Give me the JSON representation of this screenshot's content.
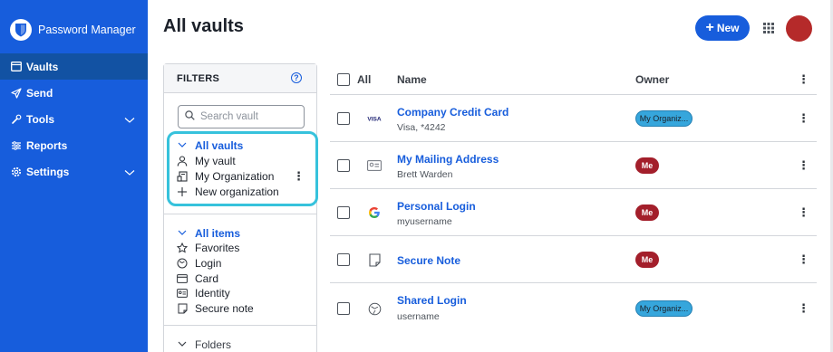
{
  "brand": {
    "name": "Password Manager"
  },
  "nav": {
    "items": [
      {
        "label": "Vaults",
        "icon": "vault-icon",
        "active": true
      },
      {
        "label": "Send",
        "icon": "send-icon"
      },
      {
        "label": "Tools",
        "icon": "tools-icon",
        "expandable": true
      },
      {
        "label": "Reports",
        "icon": "reports-icon"
      },
      {
        "label": "Settings",
        "icon": "settings-icon",
        "expandable": true
      }
    ]
  },
  "header": {
    "title": "All vaults",
    "new_label": "New"
  },
  "filters": {
    "title": "FILTERS",
    "search_placeholder": "Search vault",
    "vaults": {
      "heading": "All vaults",
      "items": [
        "My vault",
        "My Organization",
        "New organization"
      ]
    },
    "items": {
      "heading": "All items",
      "entries": [
        "Favorites",
        "Login",
        "Card",
        "Identity",
        "Secure note"
      ]
    },
    "folders": {
      "heading": "Folders"
    }
  },
  "table": {
    "headers": {
      "all": "All",
      "name": "Name",
      "owner": "Owner"
    },
    "rows": [
      {
        "name": "Company Credit Card",
        "subtitle": "Visa, *4242",
        "icon": "visa-icon",
        "owner": "My Organiz...",
        "owner_type": "org"
      },
      {
        "name": "My Mailing Address",
        "subtitle": "Brett Warden",
        "icon": "id-card-icon",
        "owner": "Me",
        "owner_type": "me"
      },
      {
        "name": "Personal Login",
        "subtitle": "myusername",
        "icon": "google-icon",
        "owner": "Me",
        "owner_type": "me"
      },
      {
        "name": "Secure Note",
        "subtitle": "",
        "icon": "note-icon",
        "owner": "Me",
        "owner_type": "me"
      },
      {
        "name": "Shared Login",
        "subtitle": "username",
        "icon": "globe-icon",
        "owner": "My Organiz...",
        "owner_type": "org"
      }
    ]
  },
  "colors": {
    "brand": "#175ddc",
    "highlight": "#36c2dc",
    "me_badge": "#a31f2b",
    "org_badge": "#36a6dc",
    "avatar": "#b52a2a"
  }
}
